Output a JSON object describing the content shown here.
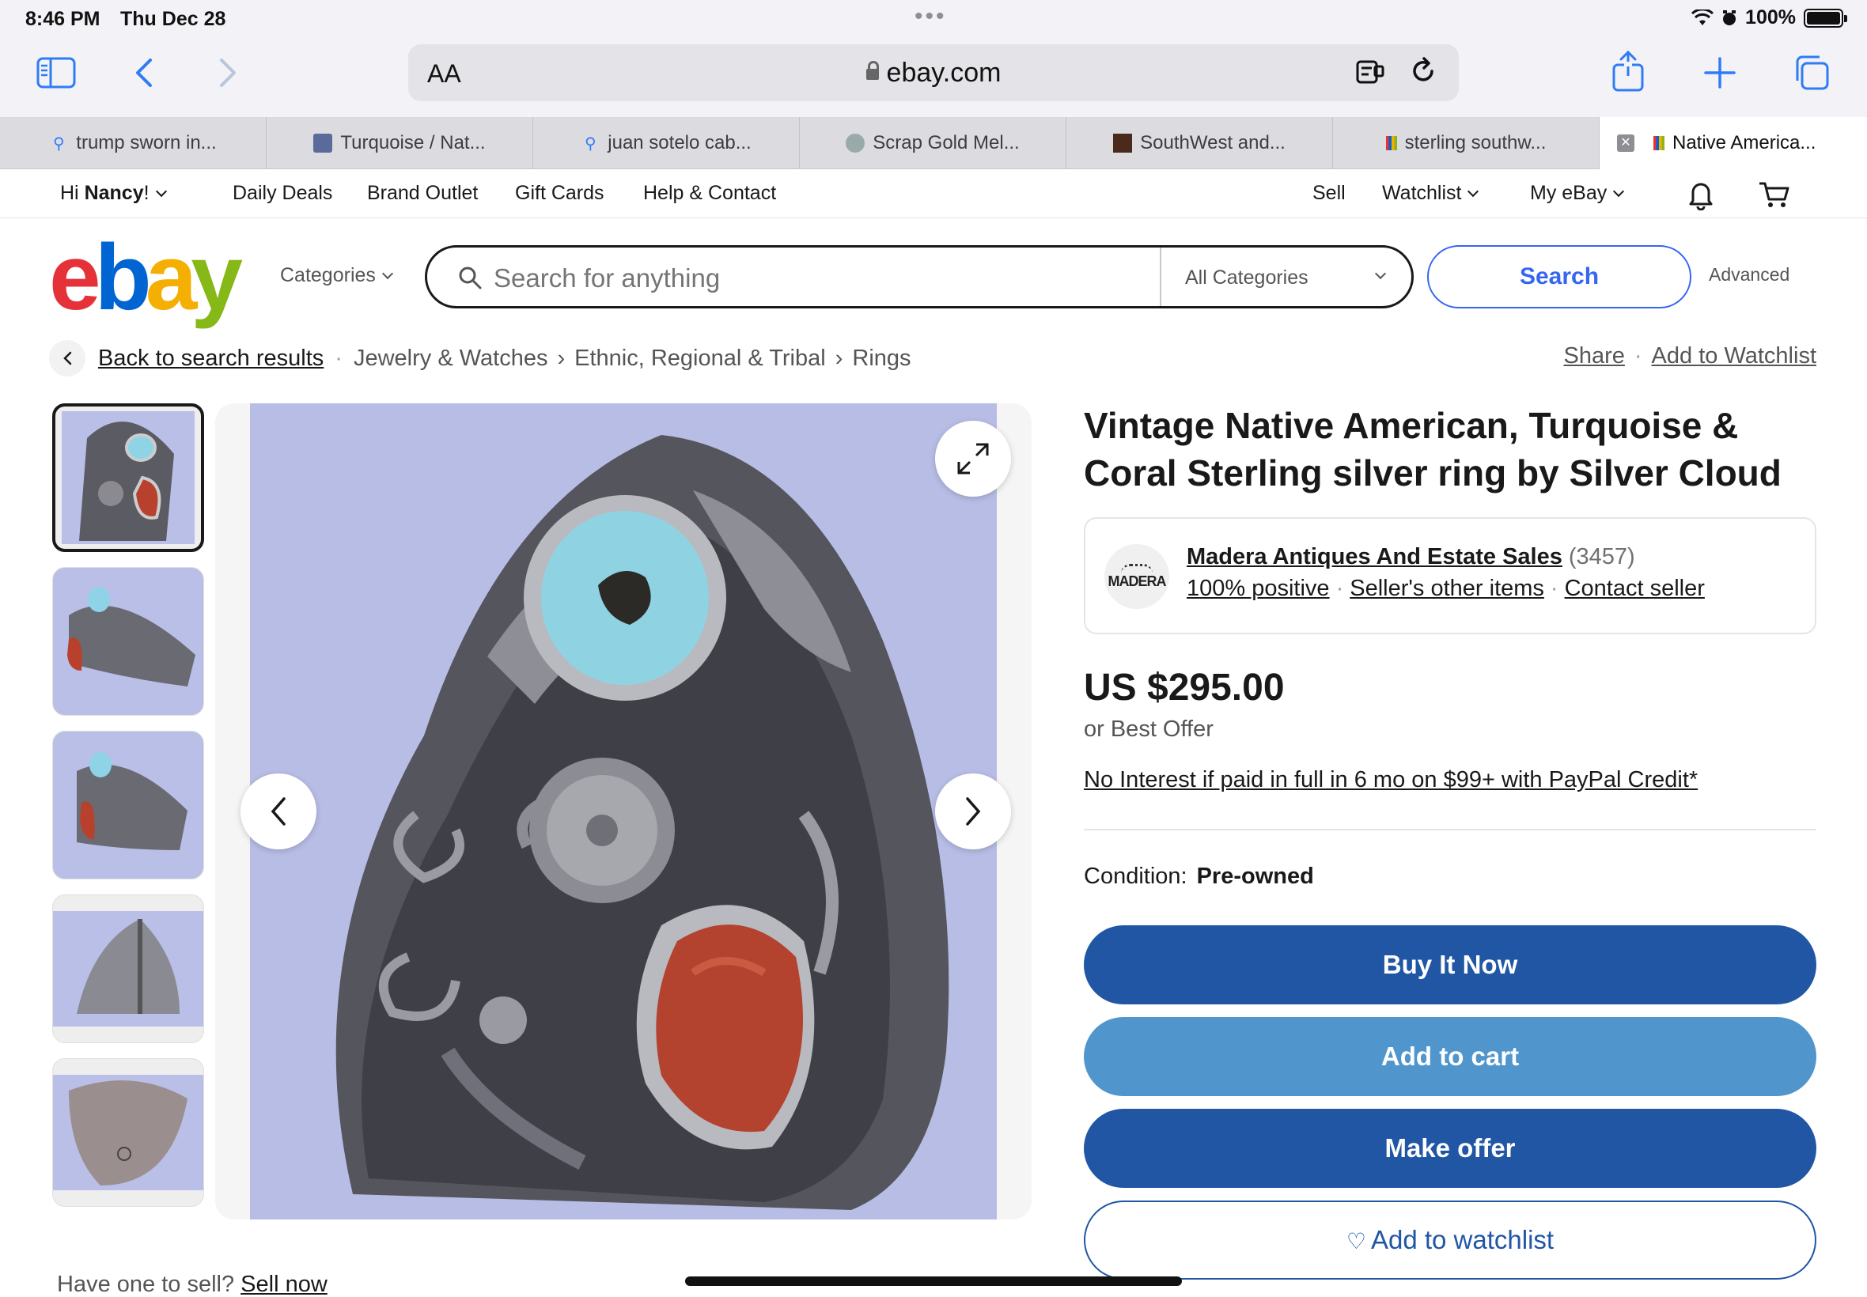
{
  "status": {
    "time": "8:46 PM",
    "date": "Thu Dec 28",
    "battery": "100%"
  },
  "browser": {
    "aa_label": "AA",
    "domain": "ebay.com",
    "accent": "#2f7cf6",
    "icons": [
      "sidebar-icon",
      "back-icon",
      "forward-icon",
      "reader-icon",
      "reload-icon",
      "share-icon",
      "new-tab-icon",
      "tabs-icon"
    ]
  },
  "tabs": [
    {
      "label": "trump sworn in...",
      "icon": "search-icon"
    },
    {
      "label": "Turquoise / Nat...",
      "icon": "site-icon"
    },
    {
      "label": "juan sotelo cab...",
      "icon": "search-icon"
    },
    {
      "label": "Scrap Gold Mel...",
      "icon": "site-icon"
    },
    {
      "label": "SouthWest and...",
      "icon": "site-icon"
    },
    {
      "label": "sterling southw...",
      "icon": "ebay-icon"
    },
    {
      "label": "Native America...",
      "icon": "ebay-icon",
      "active": true
    }
  ],
  "global_header": {
    "greeting_prefix": "Hi ",
    "user": "Nancy",
    "greeting_suffix": "!",
    "links": [
      "Daily Deals",
      "Brand Outlet",
      "Gift Cards",
      "Help & Contact"
    ],
    "sell": "Sell",
    "watchlist": "Watchlist",
    "my_ebay": "My eBay"
  },
  "search": {
    "categories_label": "Categories",
    "placeholder": "Search for anything",
    "category_select": "All Categories",
    "button": "Search",
    "advanced": "Advanced"
  },
  "breadcrumb": {
    "back": "Back to search results",
    "items": [
      "Jewelry & Watches",
      "Ethnic, Regional & Tribal",
      "Rings"
    ],
    "share": "Share",
    "add_watchlist": "Add to Watchlist"
  },
  "listing": {
    "title": "Vintage Native American, Turquoise & Coral Sterling silver ring by Silver Cloud",
    "seller_name": "Madera Antiques And Estate Sales",
    "seller_count": "(3457)",
    "seller_logo_text": "MADERA",
    "feedback": "100% positive",
    "other_items": "Seller's other items",
    "contact": "Contact seller",
    "price": "US $295.00",
    "best_offer": "or Best Offer",
    "paypal_promo": "No Interest if paid in full in 6 mo on $99+ with PayPal Credit*",
    "condition_label": "Condition:",
    "condition_value": "Pre-owned",
    "buy_now": "Buy It Now",
    "add_to_cart": "Add to cart",
    "make_offer": "Make offer",
    "add_to_watchlist": "Add to watchlist",
    "colors": {
      "primary": "#2156a5",
      "secondary": "#5096cc"
    }
  },
  "footer": {
    "have_one": "Have one to sell?",
    "sell_now": "Sell now"
  }
}
